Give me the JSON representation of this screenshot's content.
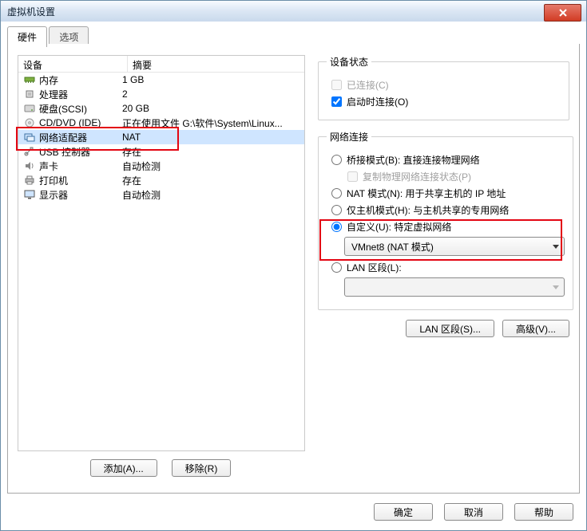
{
  "window": {
    "title": "虚拟机设置"
  },
  "tabs": {
    "hardware": "硬件",
    "options": "选项"
  },
  "columns": {
    "device": "设备",
    "summary": "摘要"
  },
  "devices": [
    {
      "icon": "memory",
      "name": "内存",
      "summary": "1 GB"
    },
    {
      "icon": "cpu",
      "name": "处理器",
      "summary": "2"
    },
    {
      "icon": "disk",
      "name": "硬盘(SCSI)",
      "summary": "20 GB"
    },
    {
      "icon": "cd",
      "name": "CD/DVD (IDE)",
      "summary": "正在使用文件 G:\\软件\\System\\Linux..."
    },
    {
      "icon": "net",
      "name": "网络适配器",
      "summary": "NAT",
      "selected": true
    },
    {
      "icon": "usb",
      "name": "USB 控制器",
      "summary": "存在"
    },
    {
      "icon": "sound",
      "name": "声卡",
      "summary": "自动检测"
    },
    {
      "icon": "printer",
      "name": "打印机",
      "summary": "存在"
    },
    {
      "icon": "display",
      "name": "显示器",
      "summary": "自动检测"
    }
  ],
  "leftButtons": {
    "add": "添加(A)...",
    "remove": "移除(R)"
  },
  "deviceStatus": {
    "legend": "设备状态",
    "connected": "已连接(C)",
    "connectOnPower": "启动时连接(O)"
  },
  "netConn": {
    "legend": "网络连接",
    "bridged": "桥接模式(B): 直接连接物理网络",
    "replicate": "复制物理网络连接状态(P)",
    "nat": "NAT 模式(N): 用于共享主机的 IP 地址",
    "hostOnly": "仅主机模式(H): 与主机共享的专用网络",
    "custom": "自定义(U): 特定虚拟网络",
    "customValue": "VMnet8 (NAT 模式)",
    "lanSegment": "LAN 区段(L):",
    "lanSegValue": ""
  },
  "rightButtons": {
    "lanSeg": "LAN 区段(S)...",
    "adv": "高级(V)..."
  },
  "dlgButtons": {
    "ok": "确定",
    "cancel": "取消",
    "help": "帮助"
  }
}
